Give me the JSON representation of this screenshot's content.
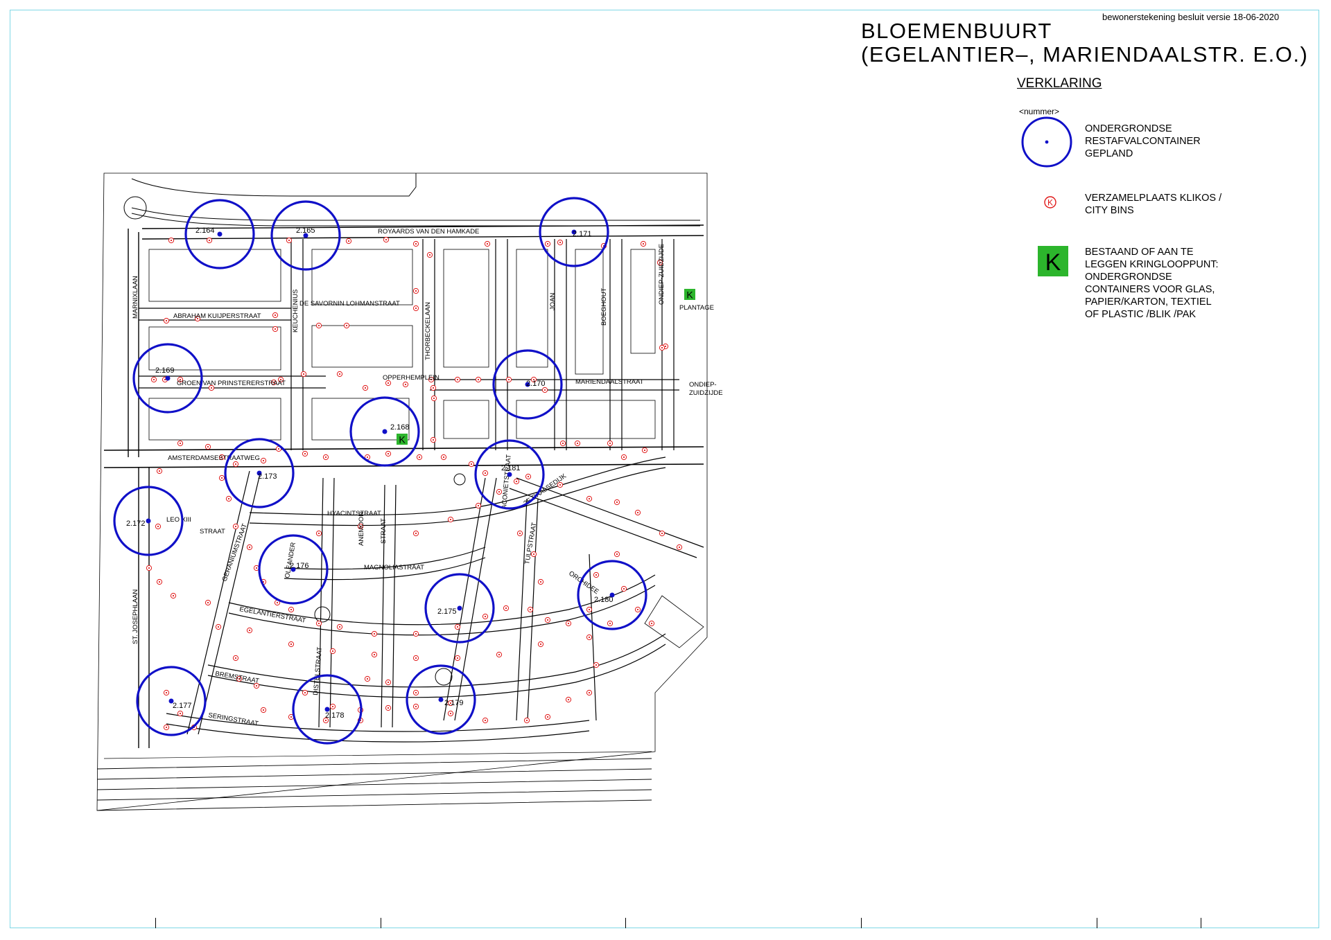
{
  "sheet": {
    "version_note": "bewonerstekening  besluit versie  18-06-2020",
    "title_line1": "BLOEMENBUURT",
    "title_line2": "(EGELANTIER–, MARIENDAALSTR. E.O.)"
  },
  "legend": {
    "heading": "VERKLARING",
    "number_placeholder": "<nummer>",
    "items": [
      {
        "symbol": "blue-circle-icon",
        "text": "ONDERGRONDSE\nRESTAFVALCONTAINER\nGEPLAND"
      },
      {
        "symbol": "k-circle-icon",
        "glyph": "K",
        "text": "VERZAMELPLAATS KLIKOS /\nCITY BINS"
      },
      {
        "symbol": "green-k-square-icon",
        "glyph": "K",
        "text": "BESTAAND OF AAN TE\nLEGGEN KRINGLOOPPUNT:\nONDERGRONDSE\nCONTAINERS VOOR GLAS,\nPAPIER/KARTON, TEXTIEL\nOF PLASTIC /BLIK /PAK"
      }
    ]
  },
  "colors": {
    "container_circle": "#1010c8",
    "klikos_marker": "#e01818",
    "kringloop_green": "#2cb52c",
    "streets": "#000000",
    "frame": "#7fd8e6"
  },
  "containers": [
    {
      "id": "2.164"
    },
    {
      "id": "2.165"
    },
    {
      "id": "2.171"
    },
    {
      "id": "2.169"
    },
    {
      "id": "2.170"
    },
    {
      "id": "2.168"
    },
    {
      "id": "2.173"
    },
    {
      "id": "2.181"
    },
    {
      "id": "2.172"
    },
    {
      "id": "2.176"
    },
    {
      "id": "2.175"
    },
    {
      "id": "2.180"
    },
    {
      "id": "2.177"
    },
    {
      "id": "2.178"
    },
    {
      "id": "2.179"
    }
  ],
  "kringloop_points": [
    {
      "glyph": "K"
    },
    {
      "glyph": "K"
    }
  ],
  "street_labels": [
    "ROYAARDS VAN DEN HAMKADE",
    "ABRAHAM KUIJPERSTRAAT",
    "DE SAVORNIN LOHMANSTRAAT",
    "GROEN VAN PRINSTERERSTRAAT",
    "OPPERHEMPLEIN",
    "MARIENDAALSTRAAT",
    "ONDIEP-ZUIDZIJDE",
    "AMSTERDAMSESTRAATWEG",
    "HYACINTSTRAAT",
    "LEO XIII",
    "STRAAT",
    "MAGNOLIASTRAAT",
    "EGELANTIERSTRAAT",
    "BREMSTRAAT",
    "SERINGSTRAAT",
    "ST. JOSEPHLAAN",
    "MARNIXLAAN",
    "2E DAALSEDIJK",
    "ORCHIDEE",
    "TULPSTRAAT",
    "PLANTAGE",
    "GERANIUMSTRAAT",
    "OLEANDER",
    "DISTELSTRAAT",
    "THORBECKELAAN",
    "KEUCHENIUS",
    "JOAN",
    "BOEGHOUT",
    "ANEMOON",
    "STRAAT",
    "ACONIETSTRAAT",
    "ONDIEP-",
    "ZUIDZIJDE"
  ]
}
